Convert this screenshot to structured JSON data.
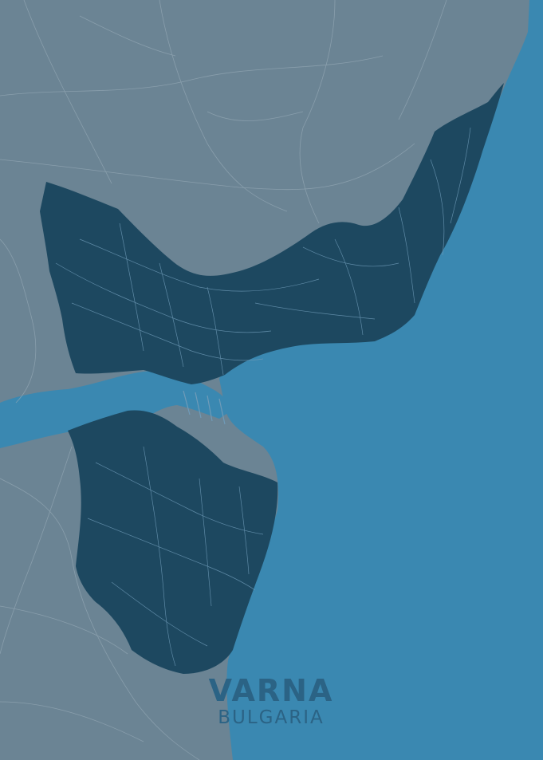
{
  "poster": {
    "city": "VARNA",
    "country": "BULGARIA"
  },
  "colors": {
    "sea": "#3a88b1",
    "land": "#6b8494",
    "city_area": "#1d4860",
    "roads_land": "#93a7b4",
    "roads_city": "#6f9bb8",
    "label": "#2b6385"
  }
}
